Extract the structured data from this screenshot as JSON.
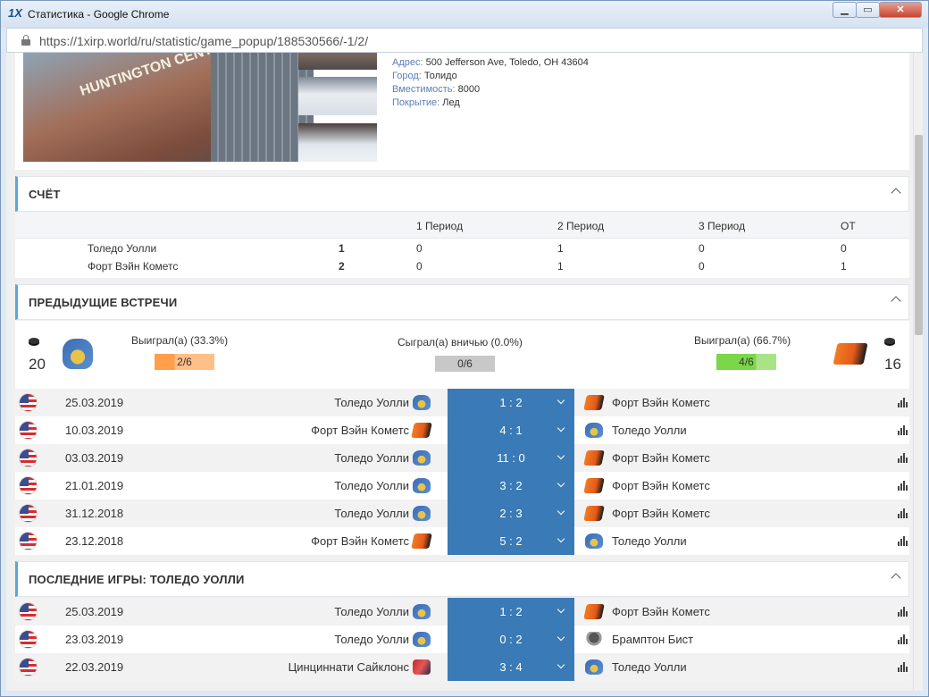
{
  "window": {
    "logo": "1X",
    "title": "Статистика - Google Chrome",
    "min_glyph": "▁",
    "max_glyph": "▭",
    "close_glyph": "✕"
  },
  "browser": {
    "url": "https://1xirp.world/ru/statistic/game_popup/188530566/-1/2/"
  },
  "venue": {
    "sign_text": "HUNTINGTON CENTER",
    "address_label": "Адрес:",
    "address": "500 Jefferson Ave, Toledo, OH 43604",
    "city_label": "Город:",
    "city": "Толидо",
    "capacity_label": "Вместимость:",
    "capacity": "8000",
    "surface_label": "Покрытие:",
    "surface": "Лед"
  },
  "score_section": {
    "title": "СЧЁТ",
    "headers": [
      "1 Период",
      "2 Период",
      "3 Период",
      "ОТ"
    ],
    "rows": [
      {
        "team": "Толедо Уолли",
        "total": "1",
        "p1": "0",
        "p2": "1",
        "p3": "0",
        "ot": "0"
      },
      {
        "team": "Форт Вэйн Кометс",
        "total": "2",
        "p1": "0",
        "p2": "1",
        "p3": "0",
        "ot": "1"
      }
    ]
  },
  "h2h_section": {
    "title": "ПРЕДЫДУЩИЕ ВСТРЕЧИ",
    "home_count": "20",
    "away_count": "16",
    "home_won_label": "Выиграл(а) (33.3%)",
    "home_won_value": "2/6",
    "home_won_fraction": 0.333,
    "draw_label": "Сыграл(а) вничью (0.0%)",
    "draw_value": "0/6",
    "draw_fraction": 0.0,
    "away_won_label": "Выиграл(а) (66.7%)",
    "away_won_value": "4/6",
    "away_won_fraction": 0.667,
    "colors": {
      "home": "#ff9f4a",
      "draw": "#c8c8c8",
      "away": "#7cd64a"
    },
    "matches": [
      {
        "date": "25.03.2019",
        "home": "Толедо Уолли",
        "home_logo": "walleye",
        "score": "1 : 2",
        "away": "Форт Вэйн Кометс",
        "away_logo": "komets"
      },
      {
        "date": "10.03.2019",
        "home": "Форт Вэйн Кометс",
        "home_logo": "komets",
        "score": "4 : 1",
        "away": "Толедо Уолли",
        "away_logo": "walleye"
      },
      {
        "date": "03.03.2019",
        "home": "Толедо Уолли",
        "home_logo": "walleye",
        "score": "11 : 0",
        "away": "Форт Вэйн Кометс",
        "away_logo": "komets"
      },
      {
        "date": "21.01.2019",
        "home": "Толедо Уолли",
        "home_logo": "walleye",
        "score": "3 : 2",
        "away": "Форт Вэйн Кометс",
        "away_logo": "komets"
      },
      {
        "date": "31.12.2018",
        "home": "Толедо Уолли",
        "home_logo": "walleye",
        "score": "2 : 3",
        "away": "Форт Вэйн Кометс",
        "away_logo": "komets"
      },
      {
        "date": "23.12.2018",
        "home": "Форт Вэйн Кометс",
        "home_logo": "komets",
        "score": "5 : 2",
        "away": "Толедо Уолли",
        "away_logo": "walleye"
      }
    ]
  },
  "last_games_section": {
    "title": "ПОСЛЕДНИЕ ИГРЫ: ТОЛЕДО УОЛЛИ",
    "matches": [
      {
        "date": "25.03.2019",
        "home": "Толедо Уолли",
        "home_logo": "walleye",
        "score": "1 : 2",
        "away": "Форт Вэйн Кометс",
        "away_logo": "komets"
      },
      {
        "date": "23.03.2019",
        "home": "Толедо Уолли",
        "home_logo": "walleye",
        "score": "0 : 2",
        "away": "Брамптон Бист",
        "away_logo": "beast"
      },
      {
        "date": "22.03.2019",
        "home": "Цинциннати Сайклонс",
        "home_logo": "cyclones",
        "score": "3 : 4",
        "away": "Толедо Уолли",
        "away_logo": "walleye"
      }
    ]
  },
  "icons": {
    "lock": "lock-icon",
    "chevron": "chevron-up-icon",
    "flag": "usa-flag-icon",
    "stats": "bar-chart-icon",
    "puck": "puck-icon",
    "dropdown": "chevron-down-icon"
  }
}
